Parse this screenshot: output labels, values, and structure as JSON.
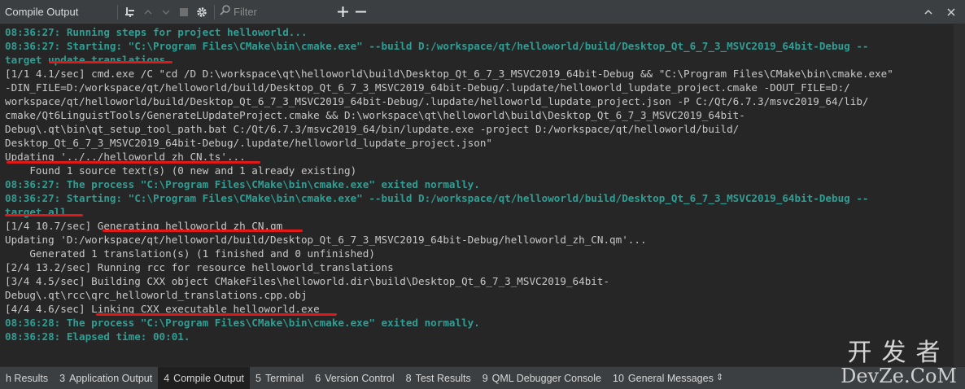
{
  "toolbar": {
    "title": "Compile Output",
    "filter_placeholder": "Filter",
    "icons": [
      "sweep-icon",
      "up-icon",
      "down-icon",
      "stop-icon",
      "gear-icon",
      "search-icon",
      "plus-icon",
      "minus-icon",
      "maximize-icon",
      "close-icon"
    ]
  },
  "lines": [
    {
      "parts": [
        {
          "t": "08:36:27: Running steps for project helloworld...",
          "c": "teal"
        }
      ]
    },
    {
      "parts": [
        {
          "t": "08:36:27: Starting: \"C:\\Program Files\\CMake\\bin\\cmake.exe\" --build D:/workspace/qt/helloworld/build/Desktop_Qt_6_7_3_MSVC2019_64bit-Debug --",
          "c": "teal"
        }
      ]
    },
    {
      "parts": [
        {
          "t": "target ",
          "c": "teal"
        },
        {
          "t": "update translations",
          "c": "teal"
        }
      ]
    },
    {
      "parts": [
        {
          "t": "[1/1 4.1/sec] cmd.exe /C \"cd /D D:\\workspace\\qt\\helloworld\\build\\Desktop_Qt_6_7_3_MSVC2019_64bit-Debug && \"C:\\Program Files\\CMake\\bin\\cmake.exe\"",
          "c": ""
        }
      ]
    },
    {
      "parts": [
        {
          "t": "-DIN_FILE=D:/workspace/qt/helloworld/build/Desktop_Qt_6_7_3_MSVC2019_64bit-Debug/.lupdate/helloworld_lupdate_project.cmake -DOUT_FILE=D:/",
          "c": ""
        }
      ]
    },
    {
      "parts": [
        {
          "t": "workspace/qt/helloworld/build/Desktop_Qt_6_7_3_MSVC2019_64bit-Debug/.lupdate/helloworld_lupdate_project.json -P C:/Qt/6.7.3/msvc2019_64/lib/",
          "c": ""
        }
      ]
    },
    {
      "parts": [
        {
          "t": "cmake/Qt6LinguistTools/GenerateLUpdateProject.cmake && D:\\workspace\\qt\\helloworld\\build\\Desktop_Qt_6_7_3_MSVC2019_64bit-",
          "c": ""
        }
      ]
    },
    {
      "parts": [
        {
          "t": "Debug\\.qt\\bin\\qt_setup_tool_path.bat C:/Qt/6.7.3/msvc2019_64/bin/lupdate.exe -project D:/workspace/qt/helloworld/build/",
          "c": ""
        }
      ]
    },
    {
      "parts": [
        {
          "t": "Desktop_Qt_6_7_3_MSVC2019_64bit-Debug/.lupdate/helloworld_lupdate_project.json\"",
          "c": ""
        }
      ]
    },
    {
      "parts": [
        {
          "t": "Updating '../../helloworld_zh_CN.ts'...",
          "c": ""
        }
      ]
    },
    {
      "parts": [
        {
          "t": "    Found 1 source text(s) (0 new and 1 already existing)",
          "c": ""
        }
      ]
    },
    {
      "parts": [
        {
          "t": "08:36:27: The process \"C:\\Program Files\\CMake\\bin\\cmake.exe\" exited normally.",
          "c": "teal"
        }
      ]
    },
    {
      "parts": [
        {
          "t": "08:36:27: Starting: \"C:\\Program Files\\CMake\\bin\\cmake.exe\" --build D:/workspace/qt/helloworld/build/Desktop_Qt_6_7_3_MSVC2019_64bit-Debug --",
          "c": "teal"
        }
      ]
    },
    {
      "parts": [
        {
          "t": "target all",
          "c": "teal"
        }
      ]
    },
    {
      "parts": [
        {
          "t": "[1/4 10.7/sec] ",
          "c": ""
        },
        {
          "t": "Generating helloworld_zh_CN.qm",
          "c": ""
        }
      ]
    },
    {
      "parts": [
        {
          "t": "Updating 'D:/workspace/qt/helloworld/build/Desktop_Qt_6_7_3_MSVC2019_64bit-Debug/helloworld_zh_CN.qm'...",
          "c": ""
        }
      ]
    },
    {
      "parts": [
        {
          "t": "    Generated 1 translation(s) (1 finished and 0 unfinished)",
          "c": ""
        }
      ]
    },
    {
      "parts": [
        {
          "t": "[2/4 13.2/sec] Running rcc for resource helloworld_translations",
          "c": ""
        }
      ]
    },
    {
      "parts": [
        {
          "t": "[3/4 4.5/sec] Building CXX object CMakeFiles\\helloworld.dir\\build\\Desktop_Qt_6_7_3_MSVC2019_64bit-",
          "c": ""
        }
      ]
    },
    {
      "parts": [
        {
          "t": "Debug\\.qt\\rcc\\qrc_helloworld_translations.cpp.obj",
          "c": ""
        }
      ]
    },
    {
      "parts": [
        {
          "t": "[4/4 4.6/sec] ",
          "c": ""
        },
        {
          "t": "Linking CXX executable helloworld.exe",
          "c": ""
        }
      ]
    },
    {
      "parts": [
        {
          "t": "08:36:28: The process \"C:\\Program Files\\CMake\\bin\\cmake.exe\" exited normally.",
          "c": "teal"
        }
      ]
    },
    {
      "parts": [
        {
          "t": "08:36:28: Elapsed time: 00:01.",
          "c": "teal"
        }
      ]
    }
  ],
  "tabs": [
    {
      "num": "",
      "label": "h Results"
    },
    {
      "num": "3",
      "label": "Application Output"
    },
    {
      "num": "4",
      "label": "Compile Output",
      "active": true
    },
    {
      "num": "5",
      "label": "Terminal"
    },
    {
      "num": "6",
      "label": "Version Control"
    },
    {
      "num": "8",
      "label": "Test Results"
    },
    {
      "num": "9",
      "label": "QML Debugger Console"
    },
    {
      "num": "10",
      "label": "General Messages"
    }
  ],
  "watermark": {
    "top": "开发者",
    "bottom": "DevZe.CoM"
  },
  "colors": {
    "accent_teal": "#2f9e94",
    "annotation_red": "#e01818",
    "panel_bg": "#262626"
  }
}
